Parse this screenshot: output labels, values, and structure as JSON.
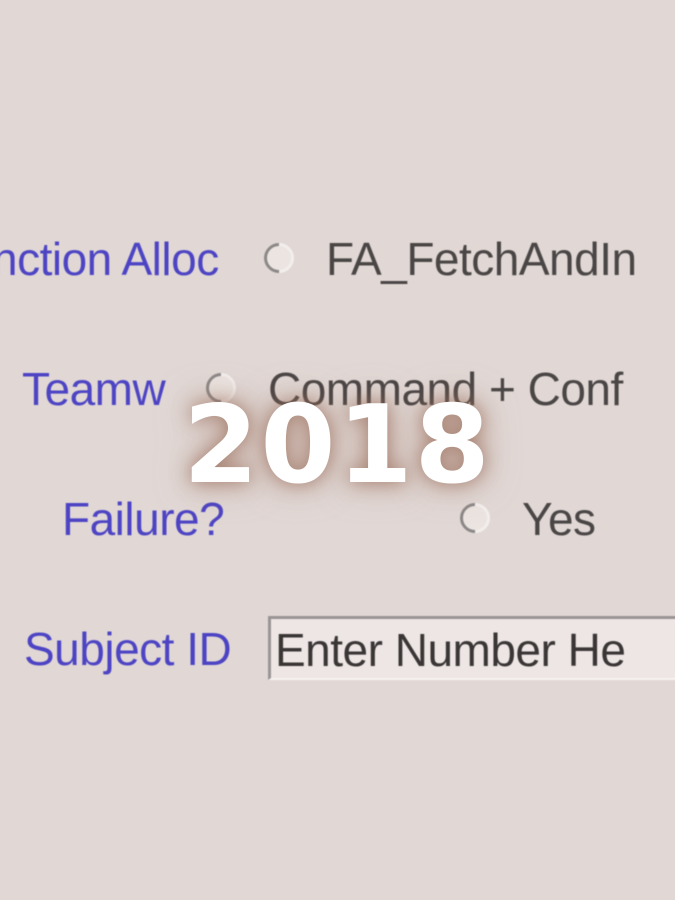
{
  "form": {
    "function_allocation": {
      "label": "nction Alloc",
      "option": "FA_FetchAndIn"
    },
    "teamwork": {
      "label": "Teamw",
      "option": "Command + Conf"
    },
    "failure": {
      "label": "Failure?",
      "option": "Yes"
    },
    "subject_id": {
      "label": "Subject ID",
      "value": "Enter Number He"
    }
  },
  "overlay": {
    "year": "2018"
  },
  "colors": {
    "background": "#e1d8d5",
    "label_blue": "#4d44c4",
    "option_text": "#4a4646"
  }
}
